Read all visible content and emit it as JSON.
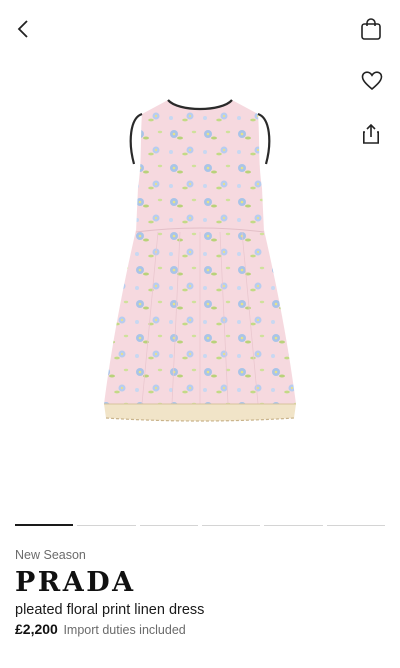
{
  "nav": {
    "back_icon": "chevron-left-icon",
    "bag_icon": "shopping-bag-icon",
    "wishlist_icon": "heart-icon",
    "share_icon": "share-icon"
  },
  "product": {
    "season": "New Season",
    "brand": "PRADA",
    "title": "pleated floral print linen dress",
    "price": "£2,200",
    "duties_note": "Import duties included"
  },
  "gallery": {
    "image_count": 6,
    "active_index": 0
  },
  "colors": {
    "pager_active": "#1a1a1a",
    "pager_inactive": "#d4d4d4",
    "dress_base": "#f6d9df"
  }
}
